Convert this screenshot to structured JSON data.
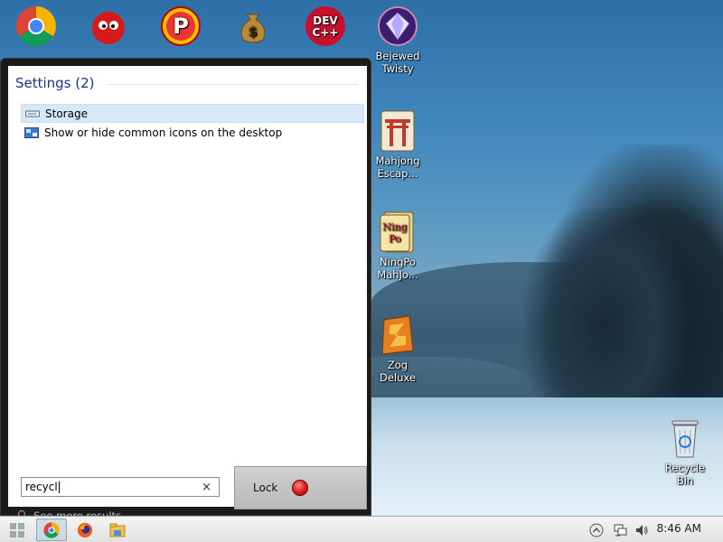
{
  "desktop": {
    "icons_top": [
      {
        "name": "chrome",
        "label": "Google Chrome"
      },
      {
        "name": "frozen-bubble",
        "label": "Frozen Bubble"
      },
      {
        "name": "peggle",
        "label": "PEGGLE"
      },
      {
        "name": "money",
        "label": "money"
      },
      {
        "name": "devcpp",
        "label": "Dev-C++"
      }
    ],
    "bejeweled_label": "Bejewed\nTwisty",
    "mahjong_escape_label": "Mahjong\nEscap...",
    "ningpo_label": "NingPo\nMahJo...",
    "zog_label": "Zog Deluxe",
    "recycle_bin_label": "Recycle Bin"
  },
  "start_menu": {
    "results_header": "Settings (2)",
    "results": [
      {
        "label": "Storage",
        "selected": true
      },
      {
        "label": "Show or hide common icons on the desktop",
        "selected": false
      }
    ],
    "see_more": "See more results",
    "search_value": "recycl",
    "clear_symbol": "×",
    "lock_label": "Lock"
  },
  "taskbar": {
    "time": "8:46 AM"
  },
  "colors": {
    "accent": "#1e3287",
    "selected_row": "#d7e8f8"
  }
}
